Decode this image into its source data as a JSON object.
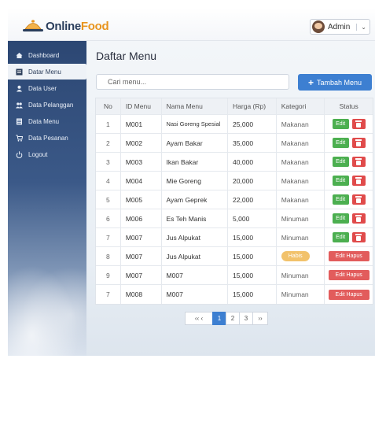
{
  "brand": {
    "name_part1": "Online",
    "name_part2": "Food"
  },
  "user": {
    "name": "Admin",
    "caret": "⌄"
  },
  "sidebar": {
    "items": [
      {
        "label": "Dashboard",
        "icon": "home-icon"
      },
      {
        "label": "Datar Menu",
        "icon": "menu-list-icon",
        "active": true
      },
      {
        "label": "Data User",
        "icon": "user-icon"
      },
      {
        "label": "Data Pelanggan",
        "icon": "users-icon"
      },
      {
        "label": "Data Menu",
        "icon": "document-icon"
      },
      {
        "label": "Data Pesanan",
        "icon": "cart-icon"
      },
      {
        "label": "Logout",
        "icon": "power-icon"
      }
    ]
  },
  "page": {
    "title": "Daftar Menu"
  },
  "search": {
    "placeholder": "Cari menu..."
  },
  "add_button": {
    "label": "Tambah Menu",
    "icon": "+"
  },
  "table": {
    "headers": [
      "No",
      "ID Menu",
      "Nama Menu",
      "Harga (Rp)",
      "Kategori",
      "Status"
    ],
    "rows": [
      {
        "no": "1",
        "id": "M001",
        "nama": "Nasi Goreng Spesial",
        "harga": "25,000",
        "kategori": "Makanan",
        "status": "edit-delete"
      },
      {
        "no": "2",
        "id": "M002",
        "nama": "Ayam Bakar",
        "harga": "35,000",
        "kategori": "Makanan",
        "status": "edit-delete"
      },
      {
        "no": "3",
        "id": "M003",
        "nama": "Ikan Bakar",
        "harga": "40,000",
        "kategori": "Makanan",
        "status": "edit-delete"
      },
      {
        "no": "4",
        "id": "M004",
        "nama": "Mie Goreng",
        "harga": "20,000",
        "kategori": "Makanan",
        "status": "edit-delete"
      },
      {
        "no": "5",
        "id": "M005",
        "nama": "Ayam Geprek",
        "harga": "22,000",
        "kategori": "Makanan",
        "status": "edit-delete"
      },
      {
        "no": "6",
        "id": "M006",
        "nama": "Es Teh Manis",
        "harga": "5,000",
        "kategori": "Minuman",
        "status": "edit-delete"
      },
      {
        "no": "7",
        "id": "M007",
        "nama": "Jus Alpukat",
        "harga": "15,000",
        "kategori": "Minuman",
        "status": "edit-delete"
      },
      {
        "no": "8",
        "id": "M007",
        "nama": "Jus Alpukat",
        "harga": "15,000",
        "kategori": "",
        "badge": "Habis",
        "status": "edit-hapus"
      },
      {
        "no": "9",
        "id": "M007",
        "nama": "M007",
        "harga": "15,000",
        "kategori": "Minuman",
        "status": "edit-hapus"
      },
      {
        "no": "7",
        "id": "M008",
        "nama": "M007",
        "harga": "15,000",
        "kategori": "Minuman",
        "status": "edit-hapus"
      }
    ],
    "edit_label": "Edit",
    "edit_hapus_label": "Edit Hapus"
  },
  "pagination": {
    "prev": "‹‹  ‹",
    "pages": [
      "1",
      "2",
      "3"
    ],
    "active": "1",
    "next": "››"
  },
  "colors": {
    "primary": "#3d7fd1",
    "success": "#4caf50",
    "danger": "#e04b4b",
    "warning": "#f2c26b",
    "brand_orange": "#e8951f"
  }
}
